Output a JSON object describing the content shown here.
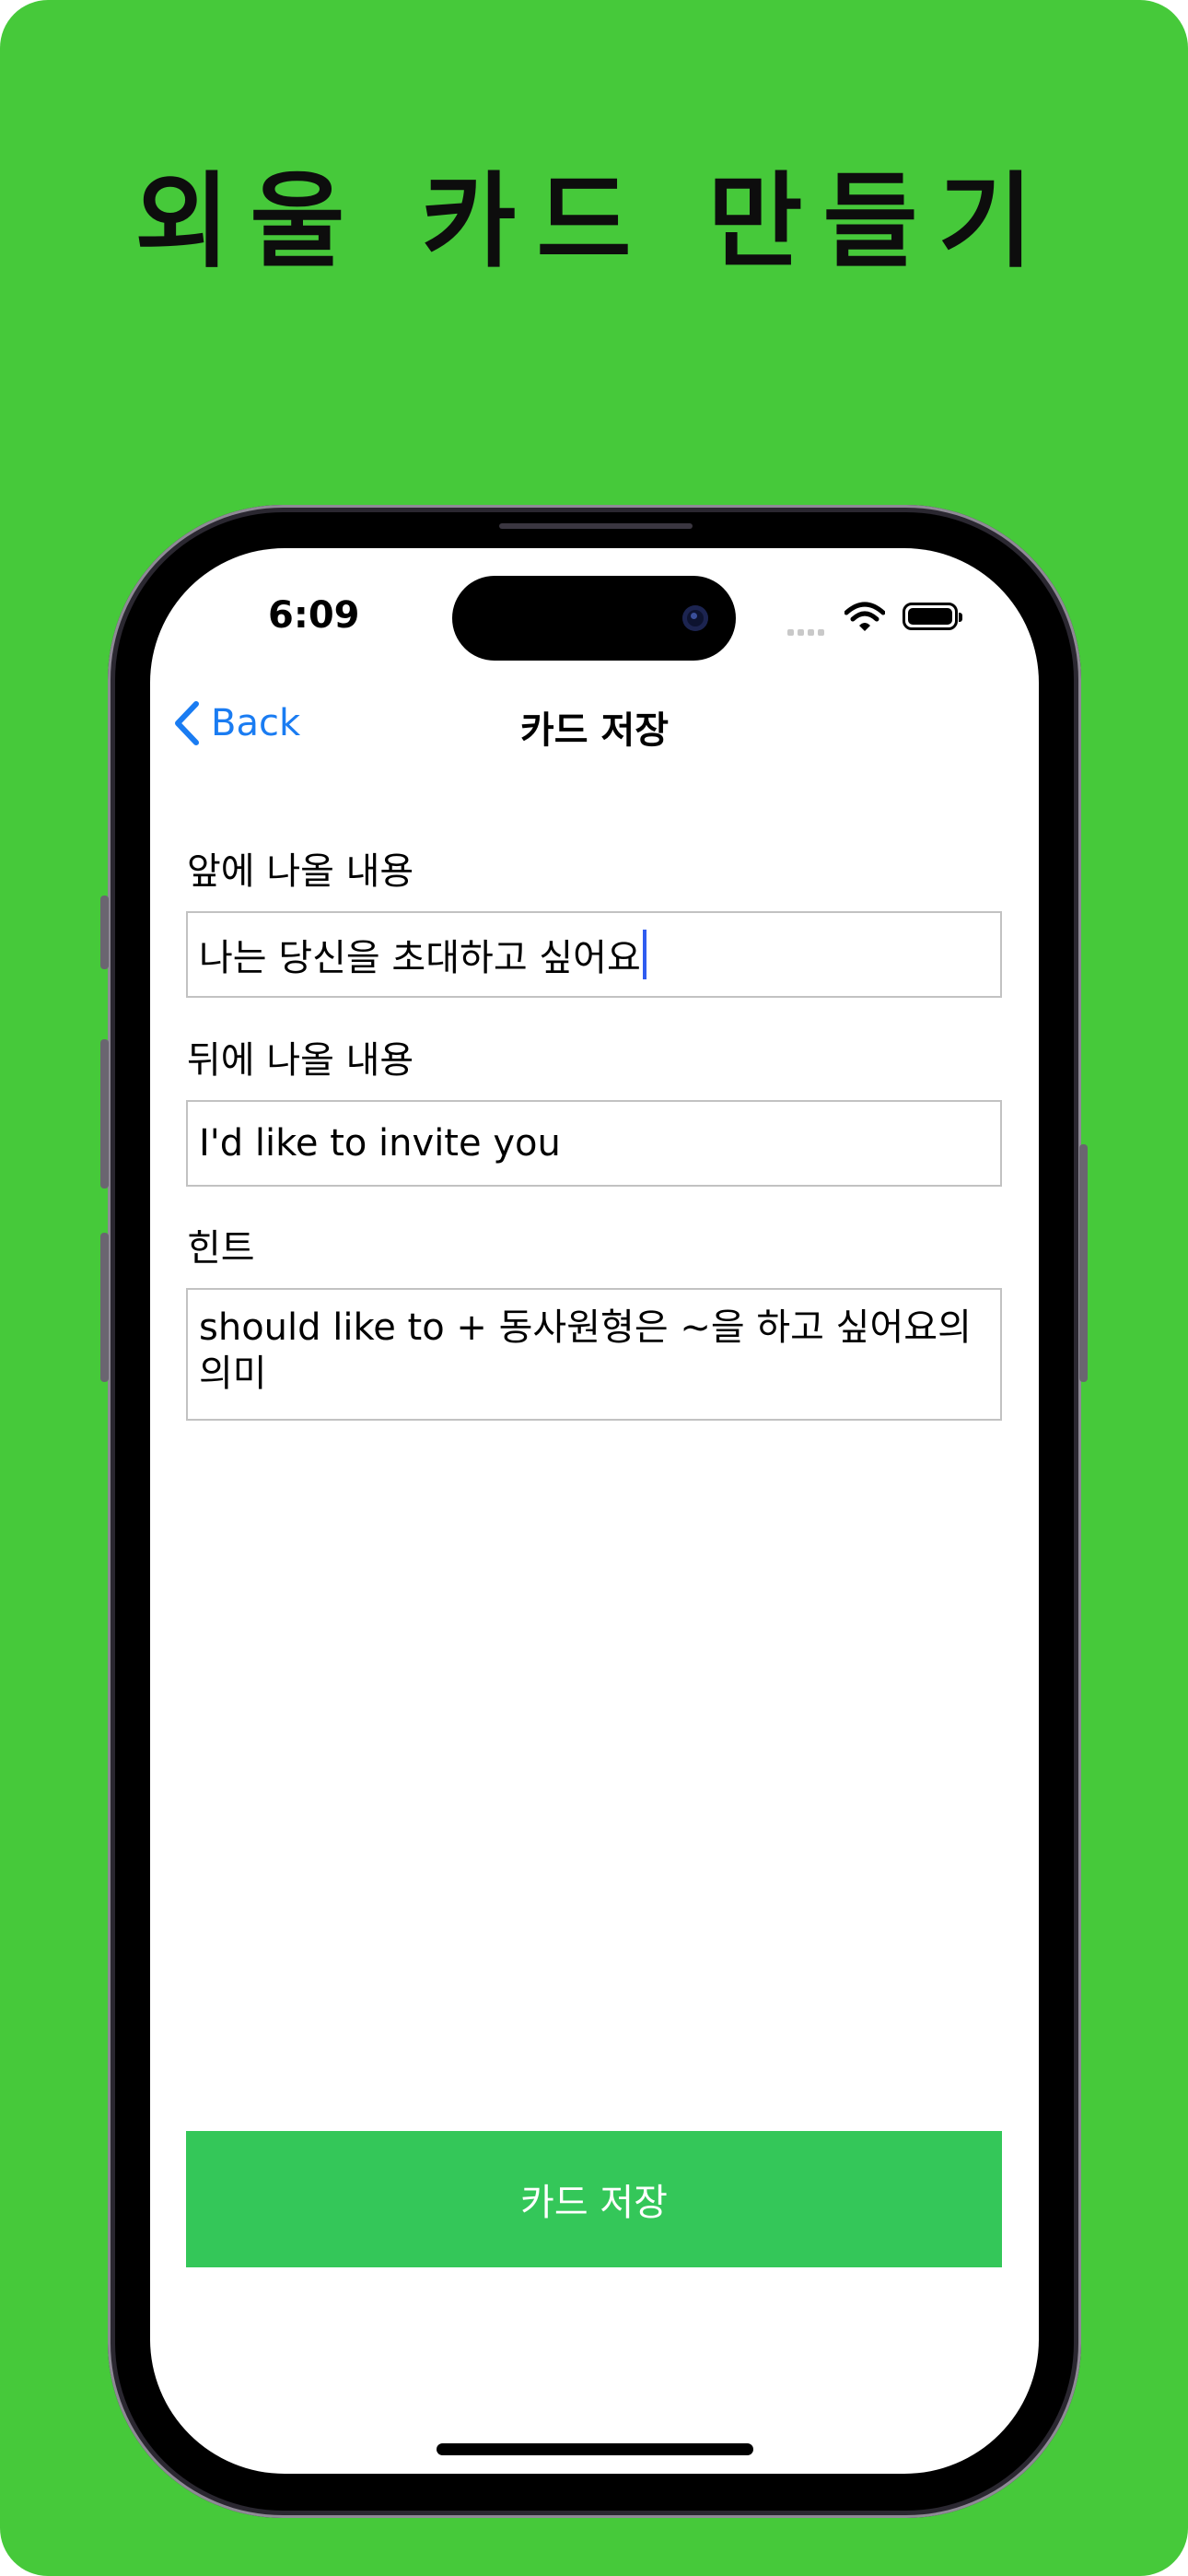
{
  "promo": {
    "title": "외울 카드 만들기"
  },
  "status_bar": {
    "time": "6:09"
  },
  "nav": {
    "back_label": "Back",
    "title": "카드 저장"
  },
  "form": {
    "front": {
      "label": "앞에 나올 내용",
      "value": "나는 당신을 초대하고 싶어요"
    },
    "back": {
      "label": "뒤에 나올 내용",
      "value": "I'd like to invite you"
    },
    "hint": {
      "label": "힌트",
      "value": "should like to + 동사원형은 ~을 하고 싶어요의 의미"
    }
  },
  "save_button": {
    "label": "카드 저장"
  },
  "colors": {
    "background": "#46c93a",
    "accent_blue": "#1a7cf2",
    "button_green": "#34c759",
    "caret": "#2f5cf0"
  },
  "icons": [
    "chevron-left-icon",
    "wifi-icon",
    "battery-icon",
    "cellular-signal-icon"
  ]
}
